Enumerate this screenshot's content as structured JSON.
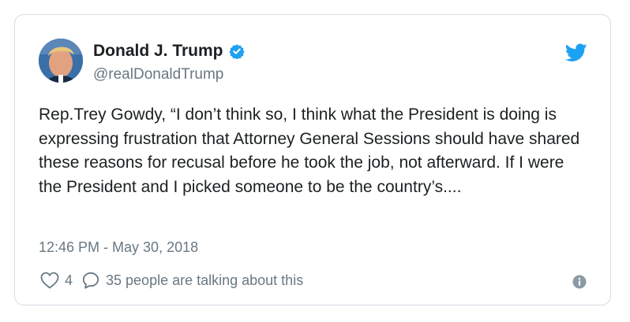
{
  "author": {
    "display_name": "Donald J. Trump",
    "handle": "@realDonaldTrump",
    "verified": true
  },
  "tweet": {
    "text": "Rep.Trey Gowdy, “I don’t think so, I think what the President is doing is expressing frustration that Attorney General Sessions should have shared these reasons for recusal before he took the job, not afterward. If I were the President and I picked someone to be the country’s....",
    "timestamp": "12:46 PM - May 30, 2018"
  },
  "engagement": {
    "likes": "4",
    "talking": "35 people are talking about this"
  },
  "icons": {
    "brand": "twitter-bird-icon",
    "verified": "verified-badge-icon",
    "like": "heart-icon",
    "reply": "reply-bubble-icon",
    "info": "info-icon"
  },
  "colors": {
    "brand_blue": "#1da1f2",
    "text_primary": "#1c2022",
    "text_secondary": "#697882",
    "border": "#d6dde3"
  }
}
